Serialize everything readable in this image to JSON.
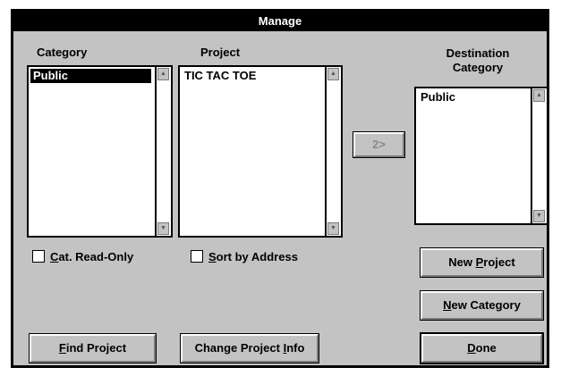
{
  "window": {
    "title": "Manage"
  },
  "category": {
    "label": "Category",
    "items": [
      "Public"
    ],
    "read_only_label_accel": "C",
    "read_only_label_rest": "at. Read-Only"
  },
  "project": {
    "label": "Project",
    "items": [
      "TIC TAC TOE"
    ],
    "sort_label_accel": "S",
    "sort_label_rest": "ort by Address"
  },
  "move_button": {
    "label": "2>"
  },
  "destination": {
    "label_line1": "Destination",
    "label_line2": "Category",
    "items": [
      "Public"
    ]
  },
  "buttons": {
    "new_project": {
      "pre": "New ",
      "accel": "P",
      "post": "roject"
    },
    "new_category": {
      "pre": "",
      "accel": "N",
      "post": "ew Category"
    },
    "find_project": {
      "pre": "",
      "accel": "F",
      "post": "ind Project"
    },
    "change_project_info": {
      "pre": "Change Project ",
      "accel": "I",
      "post": "nfo"
    },
    "done": {
      "pre": "",
      "accel": "D",
      "post": "one"
    }
  }
}
